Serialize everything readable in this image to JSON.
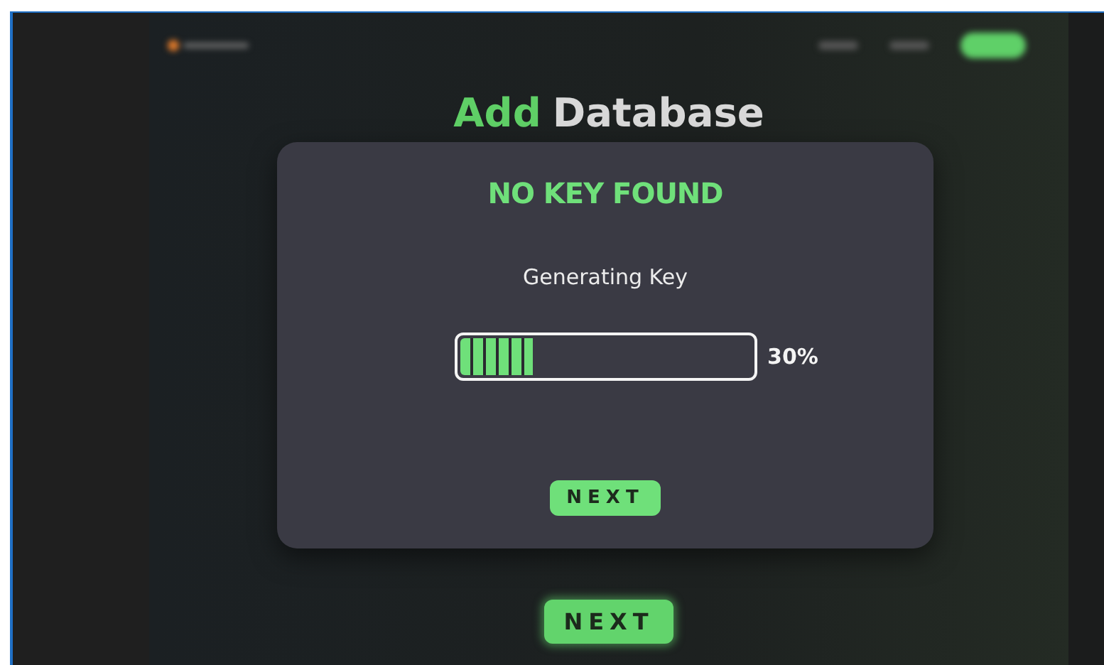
{
  "background_page": {
    "heading_accent": "Add",
    "heading_rest": "Database",
    "button": "NEXT"
  },
  "dialog": {
    "title": "NO KEY FOUND",
    "message": "Generating Key",
    "progress": {
      "level": 0.25,
      "reading": "30%"
    },
    "button": "NEXT"
  }
}
